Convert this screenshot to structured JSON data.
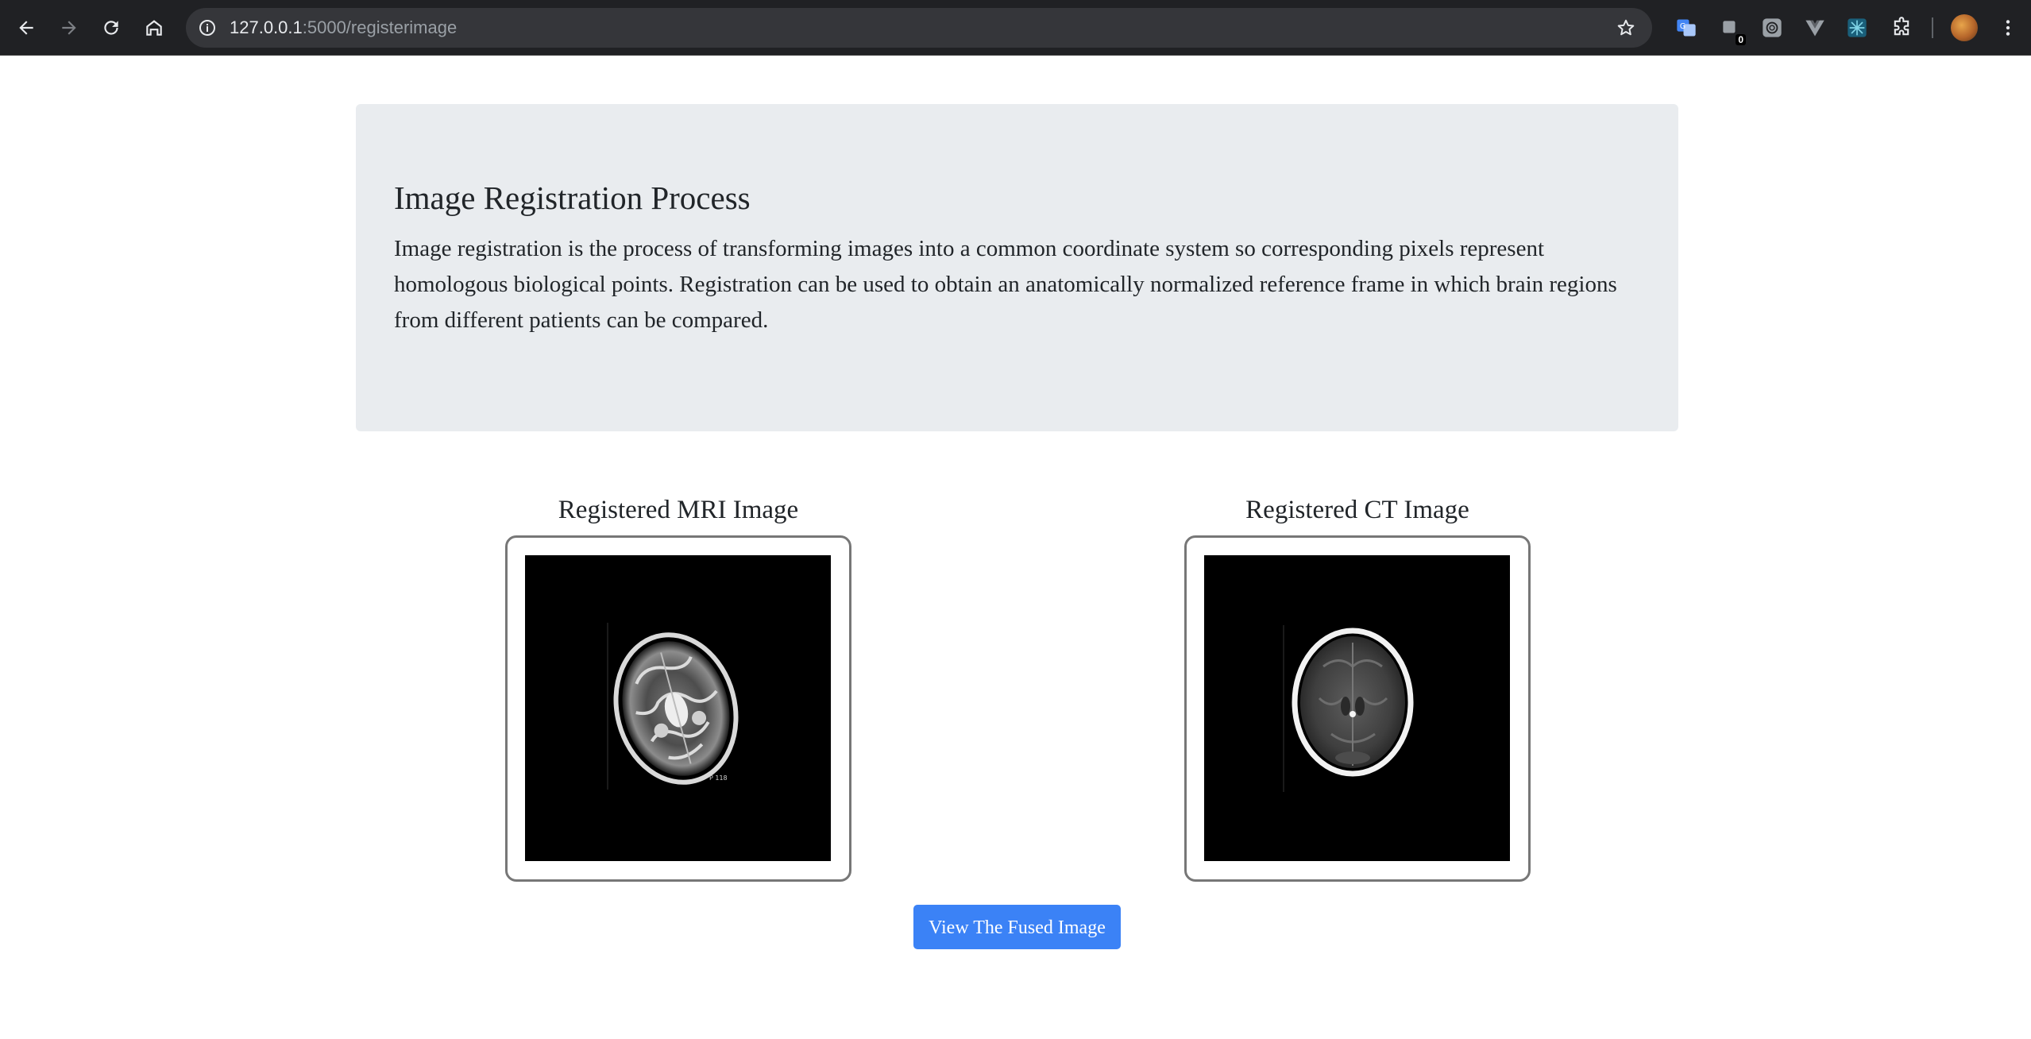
{
  "browser": {
    "url_host": "127.0.0.1",
    "url_path": ":5000/registerimage",
    "extension_badge": "0"
  },
  "jumbotron": {
    "title": "Image Registration Process",
    "description": "Image registration is the process of transforming images into a common coordinate system so corresponding pixels represent homologous biological points. Registration can be used to obtain an anatomically normalized reference frame in which brain regions from different patients can be compared."
  },
  "images": {
    "mri_title": "Registered MRI Image",
    "ct_title": "Registered CT Image"
  },
  "actions": {
    "fuse_label": "View The Fused Image"
  },
  "colors": {
    "accent": "#3b82f6",
    "panel": "#e9ecef",
    "chrome": "#202124"
  }
}
